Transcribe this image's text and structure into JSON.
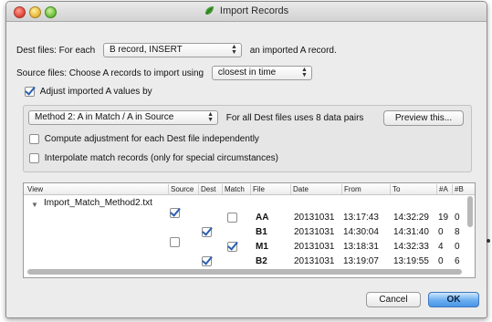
{
  "window": {
    "title": "Import Records"
  },
  "dest": {
    "prefix": "Dest files: For each",
    "popup_value": "B record, INSERT",
    "suffix": "an imported A record."
  },
  "source": {
    "prefix": "Source files: Choose A records to import using",
    "popup_value": "closest in time"
  },
  "adjust": {
    "label": "Adjust imported A values by",
    "checked": true
  },
  "method": {
    "popup_value": "Method 2: A in Match / A in Source",
    "info": "For all Dest files uses 8 data pairs",
    "preview_label": "Preview this..."
  },
  "options": {
    "compute_label": "Compute adjustment for each Dest file independently",
    "interpolate_label": "Interpolate match records (only for special circumstances)"
  },
  "table": {
    "columns": [
      "View",
      "Source",
      "Dest",
      "Match",
      "File",
      "Date",
      "From",
      "To",
      "#A",
      "#B"
    ],
    "group_name": "Import_Match_Method2.txt",
    "rows": [
      {
        "source": "checked",
        "dest": "",
        "match": "unchecked",
        "file": "AA",
        "date": "20131031",
        "from": "13:17:43",
        "to": "14:32:29",
        "a": "19",
        "b": "0"
      },
      {
        "source": "",
        "dest": "checked",
        "match": "",
        "file": "B1",
        "date": "20131031",
        "from": "14:30:04",
        "to": "14:31:40",
        "a": "0",
        "b": "8"
      },
      {
        "source": "unchecked",
        "dest": "",
        "match": "checked",
        "file": "M1",
        "date": "20131031",
        "from": "13:18:31",
        "to": "14:32:33",
        "a": "4",
        "b": "0"
      },
      {
        "source": "",
        "dest": "checked",
        "match": "",
        "file": "B2",
        "date": "20131031",
        "from": "13:19:07",
        "to": "13:19:55",
        "a": "0",
        "b": "6"
      }
    ]
  },
  "buttons": {
    "cancel": "Cancel",
    "ok": "OK"
  },
  "colors": {
    "accent": "#4a95e6",
    "checkmark": "#2a5fb0",
    "window_bg": "#ececec"
  }
}
